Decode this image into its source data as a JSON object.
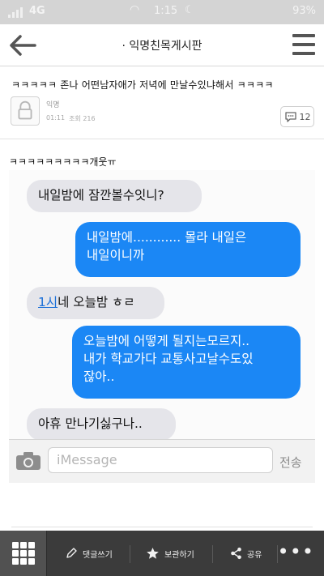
{
  "status_bar": {
    "network": "4G",
    "time": "1:15",
    "battery": "93%"
  },
  "header": {
    "title": "· 익명친목게시판",
    "back_icon": "back-arrow-icon",
    "menu_icon": "hamburger-menu-icon"
  },
  "post": {
    "title": "ㅋㅋㅋㅋㅋ 존나 어떤남자애가 저녁에 만날수있냐해서 ㅋㅋㅋㅋ",
    "author": "익명",
    "time": "01:11",
    "views": "조회 216",
    "comment_count": "12",
    "body": "ㅋㅋㅋㅋㅋㅋㅋㅋㅋ개웃ㅠ"
  },
  "messages": [
    {
      "side": "received",
      "text": "내일밤에 잠깐볼수잇니?"
    },
    {
      "side": "sent",
      "line1": "내일밤에............ 몰라 내일은",
      "line2": "내일이니까"
    },
    {
      "side": "received",
      "link": "1시",
      "rest": "네 오늘밤 ㅎㄹ"
    },
    {
      "side": "sent",
      "line1": "오늘밤에 어떻게 될지는모르지..",
      "line2": "내가 학교가다 교통사고날수도있",
      "line3": "잖아.."
    },
    {
      "side": "received",
      "text": "아휴 만나기싫구나.."
    }
  ],
  "composer": {
    "placeholder": "iMessage",
    "send_label": "전송"
  },
  "toolbar": {
    "write_comment": "댓글쓰기",
    "bookmark": "보관하기",
    "share": "공유",
    "more": "•••"
  },
  "colors": {
    "sent_bubble": "#1b87f5",
    "received_bubble": "#e5e5ea",
    "toolbar_bg": "#3b3b3b"
  }
}
